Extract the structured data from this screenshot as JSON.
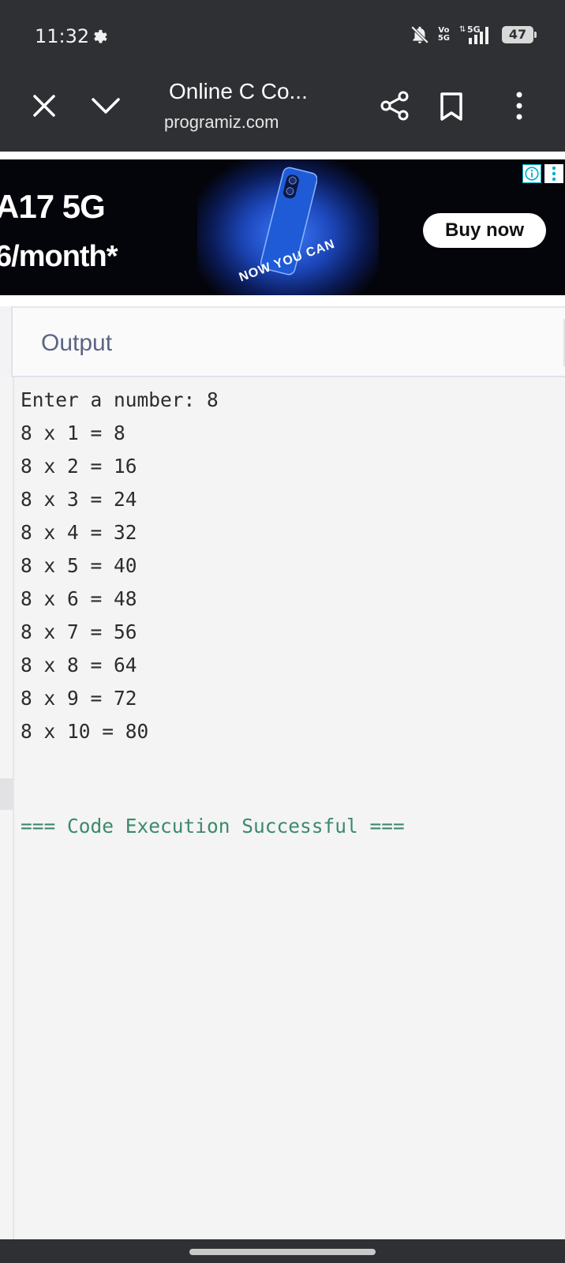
{
  "status_bar": {
    "time": "11:32",
    "network_top": "Vo",
    "network_bottom": "5G",
    "signal_label": "5G",
    "battery": "47"
  },
  "browser": {
    "page_title": "Online C Co...",
    "url": "programiz.com"
  },
  "ad": {
    "headline": "A17 5G",
    "price": "6/month*",
    "tagline": "NOW YOU CAN",
    "cta": "Buy now"
  },
  "output_panel": {
    "title": "Output",
    "lines": [
      "Enter a number: 8",
      "8 x 1 = 8",
      "8 x 2 = 16",
      "8 x 3 = 24",
      "8 x 4 = 32",
      "8 x 5 = 40",
      "8 x 6 = 48",
      "8 x 7 = 56",
      "8 x 8 = 64",
      "8 x 9 = 72",
      "8 x 10 = 80"
    ],
    "status": "=== Code Execution Successful ==="
  },
  "colors": {
    "chrome": "#2f3033",
    "title_text": "#5c6482",
    "success_text": "#3c8a6a",
    "ad_accent": "#00aecd"
  }
}
